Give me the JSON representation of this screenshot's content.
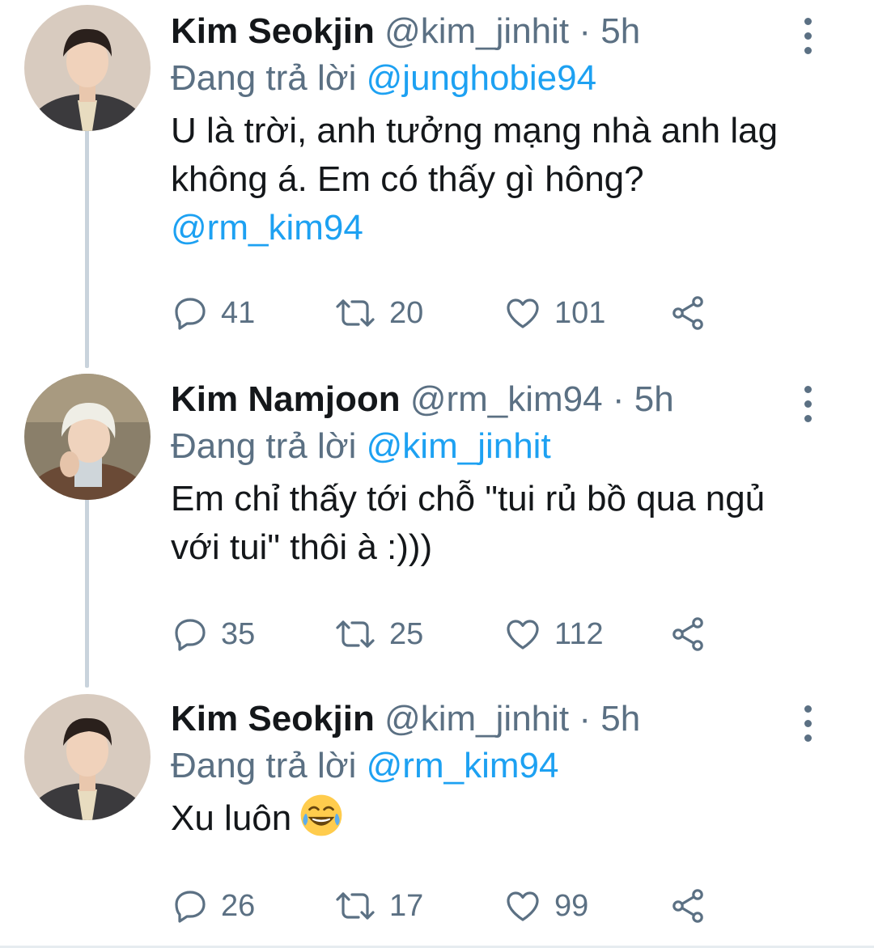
{
  "tweets": [
    {
      "name": "Kim Seokjin",
      "handle": "@kim_jinhit",
      "separator": "·",
      "time": "5h",
      "reply_prefix": "Đang trả lời",
      "reply_to": "@junghobie94",
      "text": "U là trời, anh tưởng mạng nhà anh lag không á. Em có thấy gì hông?",
      "text_mention": "@rm_kim94",
      "replies": "41",
      "retweets": "20",
      "likes": "101"
    },
    {
      "name": "Kim Namjoon",
      "handle": "@rm_kim94",
      "separator": "·",
      "time": "5h",
      "reply_prefix": "Đang trả lời",
      "reply_to": "@kim_jinhit",
      "text": "Em chỉ thấy tới chỗ \"tui rủ bồ qua ngủ với tui\" thôi à :)))",
      "replies": "35",
      "retweets": "25",
      "likes": "112"
    },
    {
      "name": "Kim Seokjin",
      "handle": "@kim_jinhit",
      "separator": "·",
      "time": "5h",
      "reply_prefix": "Đang trả lời",
      "reply_to": "@rm_kim94",
      "text": "Xu luôn",
      "emoji": "face-with-tears-of-joy",
      "replies": "26",
      "retweets": "17",
      "likes": "99"
    }
  ],
  "icons": {
    "reply": "reply-icon",
    "retweet": "retweet-icon",
    "like": "heart-icon",
    "share": "share-icon",
    "more": "more-vertical-icon"
  },
  "colors": {
    "text": "#14171a",
    "secondary": "#5b7083",
    "link": "#1da1f2",
    "thread_line": "#c9d3dc"
  }
}
